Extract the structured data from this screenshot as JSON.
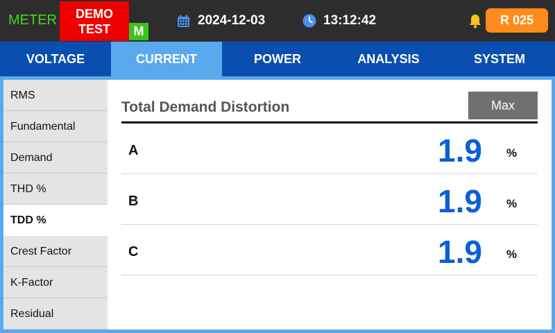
{
  "status_bar": {
    "meter_label": "METER",
    "demo_badge": "DEMO TEST",
    "mode_badge": "M",
    "date": "2024-12-03",
    "time": "13:12:42",
    "record_label": "R 025"
  },
  "tabs": [
    "VOLTAGE",
    "CURRENT",
    "POWER",
    "ANALYSIS",
    "SYSTEM"
  ],
  "active_tab": "CURRENT",
  "sidebar": {
    "items": [
      "RMS",
      "Fundamental",
      "Demand",
      "THD %",
      "TDD %",
      "Crest Factor",
      "K-Factor",
      "Residual"
    ],
    "active_item": "TDD %"
  },
  "panel": {
    "title": "Total Demand Distortion",
    "max_button_label": "Max",
    "rows": [
      {
        "phase": "A",
        "value": "1.9",
        "unit": "%"
      },
      {
        "phase": "B",
        "value": "1.9",
        "unit": "%"
      },
      {
        "phase": "C",
        "value": "1.9",
        "unit": "%"
      }
    ]
  },
  "colors": {
    "status_bg": "#2d2d2d",
    "meter_green": "#3ddc1e",
    "demo_red": "#ee0000",
    "mode_green": "#3cc41e",
    "record_orange": "#ff8c1a",
    "tabbar_blue": "#0a4faf",
    "active_tab_blue": "#5aa9ee",
    "value_blue": "#0a60d6",
    "max_button_gray": "#707070"
  },
  "icons": {
    "date": "calendar-icon",
    "time": "clock-icon",
    "alarm": "bell-icon"
  }
}
